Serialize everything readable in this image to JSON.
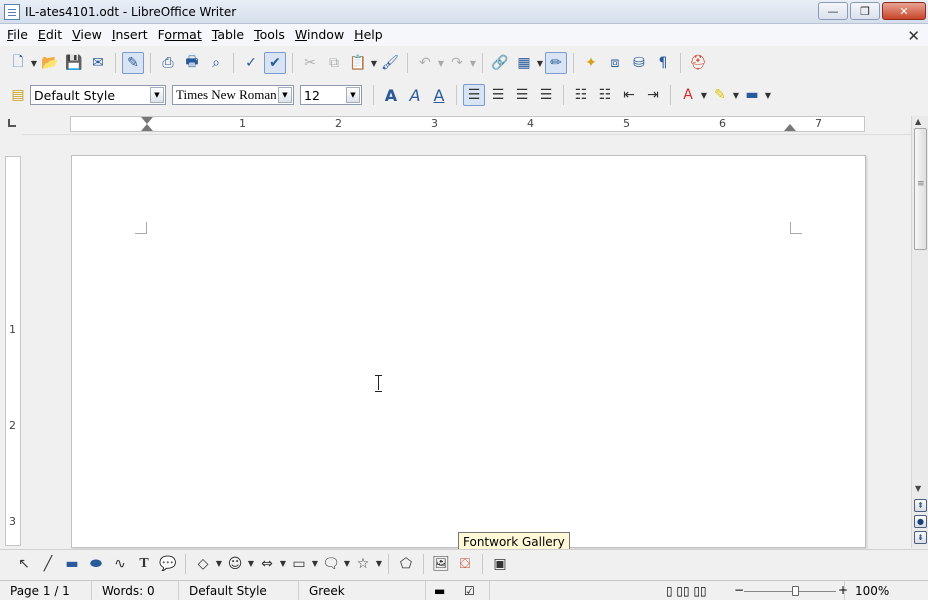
{
  "window": {
    "title": "IL-ates4101.odt - LibreOffice Writer",
    "minimize": "—",
    "restore": "❐",
    "close": "✕"
  },
  "menubar": {
    "items": [
      {
        "mn": "F",
        "rest": "ile"
      },
      {
        "mn": "E",
        "rest": "dit"
      },
      {
        "mn": "V",
        "rest": "iew"
      },
      {
        "mn": "I",
        "rest": "nsert"
      },
      {
        "mn": "F",
        "rest": "ormat",
        "pre": ""
      },
      {
        "mn": "T",
        "rest": "able"
      },
      {
        "mn": "T",
        "rest": "ools"
      },
      {
        "mn": "W",
        "rest": "indow"
      },
      {
        "mn": "H",
        "rest": "elp"
      }
    ],
    "close_doc": "✕"
  },
  "formatting": {
    "paragraph_style": "Default Style",
    "font_name": "Times New Roman",
    "font_size": "12"
  },
  "ruler": {
    "h_numbers": [
      "1",
      "2",
      "3",
      "4",
      "5",
      "6",
      "7"
    ],
    "v_numbers": [
      "1",
      "2",
      "3"
    ]
  },
  "tooltip": "Fontwork Gallery",
  "statusbar": {
    "page": "Page 1 / 1",
    "words": "Words: 0",
    "style": "Default Style",
    "language": "Greek",
    "zoom": "100%"
  },
  "icons": {
    "colors": {
      "accent": "#2a5a9a",
      "active_bg": "#d8e4f4"
    }
  }
}
